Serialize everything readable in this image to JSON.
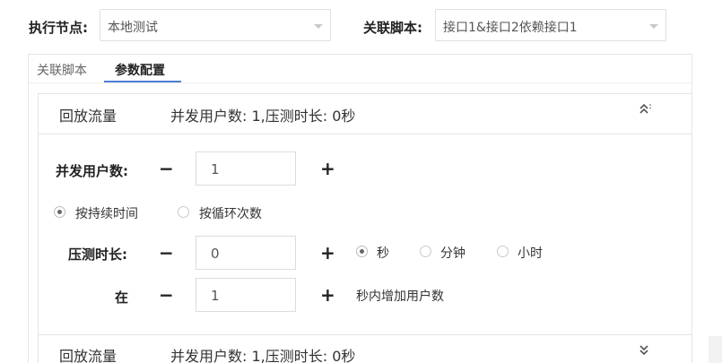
{
  "header": {
    "node_label": "执行节点:",
    "node_value": "本地测试",
    "script_label": "关联脚本:",
    "script_value": "接口1&接口2依赖接口1"
  },
  "tabs": [
    {
      "label": "关联脚本",
      "active": false
    },
    {
      "label": "参数配置",
      "active": true
    }
  ],
  "panels": [
    {
      "title": "回放流量",
      "summary": "并发用户数: 1,压测时长: 0秒",
      "expanded": true,
      "chevron": "chevron-double-up-icon"
    },
    {
      "title": "回放流量",
      "summary": "并发用户数: 1,压测时长: 0秒",
      "expanded": false,
      "chevron": "chevron-double-down-icon"
    }
  ],
  "config": {
    "concurrent_label": "并发用户数:",
    "concurrent_value": "1",
    "mode_options": [
      "按持续时间",
      "按循环次数"
    ],
    "mode_selected": "按持续时间",
    "duration_label": "压测时长:",
    "duration_value": "0",
    "unit_options": [
      "秒",
      "分钟",
      "小时"
    ],
    "unit_selected": "秒",
    "ramp_label": "在",
    "ramp_value": "1",
    "ramp_suffix": "秒内增加用户数",
    "minus_symbol": "−",
    "plus_symbol": "+"
  },
  "colors": {
    "accent": "#4a7fd4",
    "border": "#dcdfe6"
  }
}
